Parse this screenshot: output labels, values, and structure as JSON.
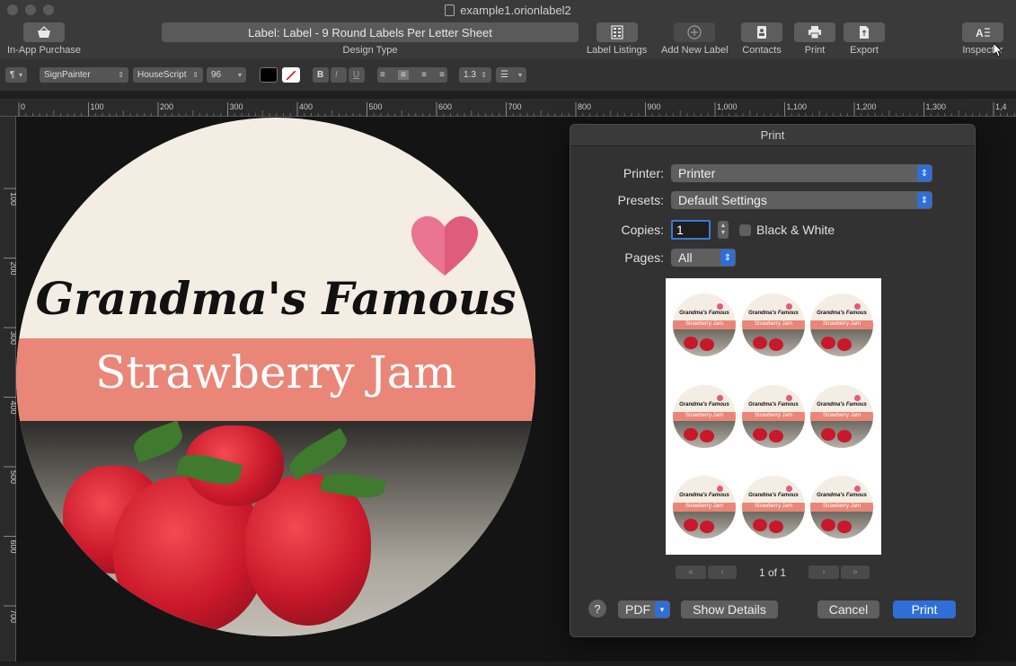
{
  "window": {
    "title": "example1.orionlabel2"
  },
  "toolbar": {
    "in_app_purchase": "In-App Purchase",
    "design_type_value": "Label: Label - 9 Round Labels Per Letter Sheet",
    "design_type_label": "Design Type",
    "label_listings": "Label Listings",
    "add_new_label": "Add New Label",
    "contacts": "Contacts",
    "print": "Print",
    "export": "Export",
    "inspector": "Inspector"
  },
  "format_bar": {
    "paragraph": "¶",
    "font_family": "SignPainter",
    "font_style": "HouseScript",
    "font_size": "96",
    "bold": "B",
    "italic": "I",
    "underline": "U",
    "line_spacing": "1.3"
  },
  "ruler": {
    "h_ticks": [
      "0",
      "100",
      "200",
      "300",
      "400",
      "500",
      "600",
      "700",
      "800",
      "900",
      "1,000",
      "1,100",
      "1,200",
      "1,300",
      "1,4"
    ],
    "v_ticks": [
      "100",
      "200",
      "300",
      "400",
      "500",
      "600",
      "700"
    ]
  },
  "label": {
    "line1": "Grandma's Famous",
    "line2": "Strawberry Jam"
  },
  "print_dialog": {
    "title": "Print",
    "printer_label": "Printer:",
    "printer_value": "Printer",
    "presets_label": "Presets:",
    "presets_value": "Default Settings",
    "copies_label": "Copies:",
    "copies_value": "1",
    "bw_label": "Black & White",
    "pages_label": "Pages:",
    "pages_value": "All",
    "page_indicator": "1 of 1",
    "help": "?",
    "pdf_label": "PDF",
    "show_details": "Show Details",
    "cancel": "Cancel",
    "print": "Print"
  },
  "colors": {
    "band": "#e98677",
    "cream": "#f4ede3",
    "accent_blue": "#2f6ed6",
    "heart": "#e05c7c"
  }
}
